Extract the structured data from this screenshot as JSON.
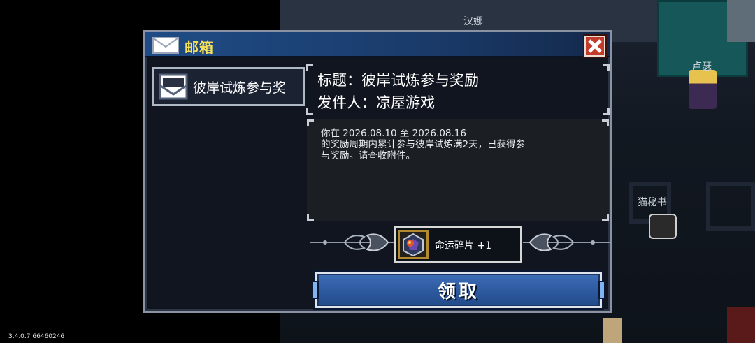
{
  "scene": {
    "labels": [
      "汉娜",
      "卢瑟",
      "猫秘书"
    ]
  },
  "version_text": "3.4.0.7 66460246",
  "mailbox": {
    "title": "邮箱",
    "close_icon": "close-x-icon",
    "mail_list": [
      {
        "label": "彼岸试炼参与奖",
        "icon": "envelope-icon",
        "selected": true
      }
    ],
    "detail": {
      "subject_line": "标题：彼岸试炼参与奖励",
      "sender_line": "发件人：凉屋游戏",
      "body_lines": [
        "你在 2026.08.10 至 2026.08.16",
        "的奖励周期内累计参与彼岸试炼满2天，已获得参",
        "与奖励。请查收附件。"
      ]
    },
    "attachment": {
      "name": "命运碎片",
      "quantity": "+1",
      "icon": "fate-shard-icon"
    },
    "claim_button_label": "领取"
  },
  "colors": {
    "title_text": "#f6e15a",
    "titlebar": "#1f4c86",
    "claim_button": "#2e5aa0",
    "close_button": "#c23b2c"
  }
}
